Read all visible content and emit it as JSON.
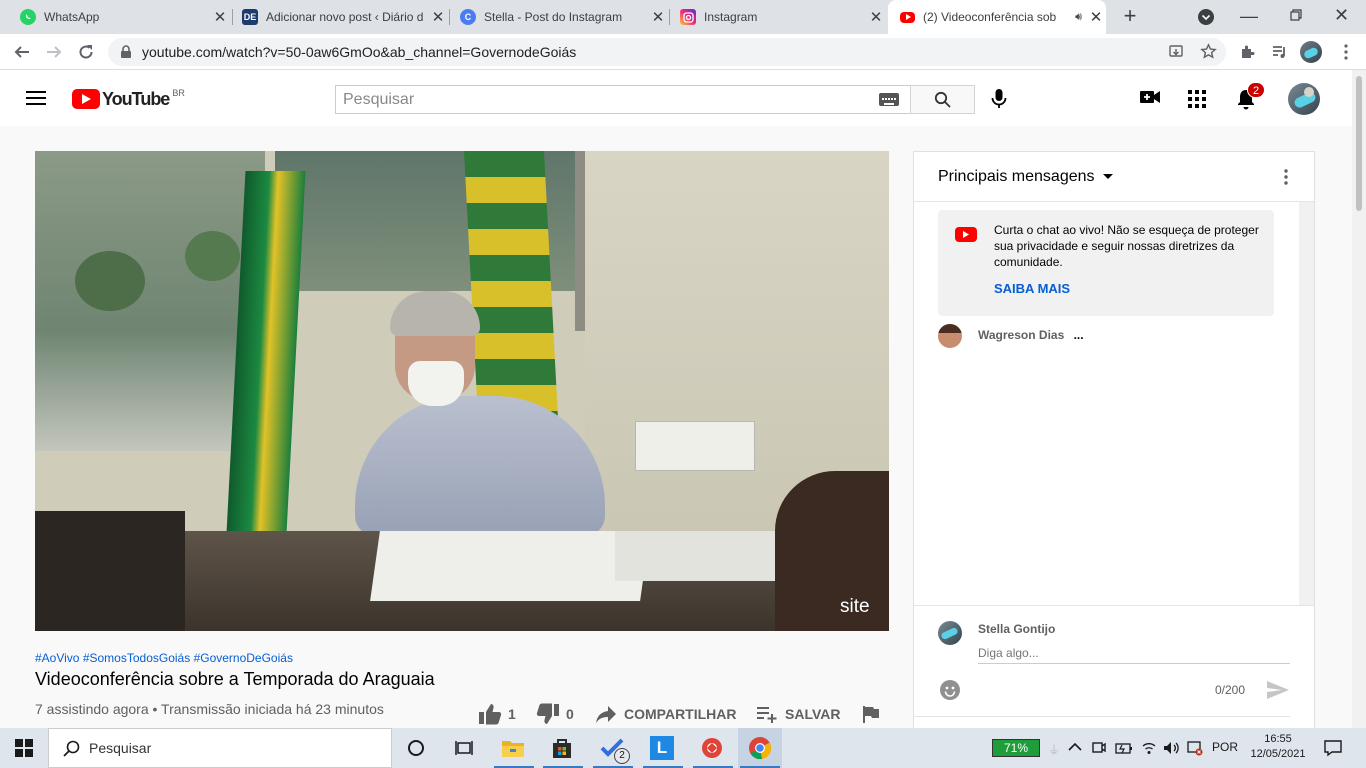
{
  "browser": {
    "tabs": [
      {
        "title": "WhatsApp",
        "icon": "whatsapp-icon",
        "color": "#25d366",
        "active": false
      },
      {
        "title": "Adicionar novo post ‹ Diário d",
        "icon": "diario-icon",
        "color": "#1d3c6e",
        "active": false
      },
      {
        "title": "Stella - Post do Instagram",
        "icon": "canva-icon",
        "color": "#4b7cf0",
        "active": false
      },
      {
        "title": "Instagram",
        "icon": "instagram-icon",
        "color": "#d62976",
        "active": false
      },
      {
        "title": "(2) Videoconferência sob",
        "icon": "youtube-icon",
        "color": "#ff0000",
        "active": true
      }
    ],
    "url": "youtube.com/watch?v=50-0aw6GmOo&ab_channel=GovernodeGoiás"
  },
  "youtube": {
    "logo_text": "YouTube",
    "country_code": "BR",
    "search_placeholder": "Pesquisar",
    "notification_count": "2",
    "brand_red": "#ff0000"
  },
  "video": {
    "watermark": "site",
    "hashtags": [
      "#AoVivo",
      "#SomosTodosGoiás",
      "#GovernoDeGoiás"
    ],
    "title": "Videoconferência sobre a Temporada do Araguaia",
    "meta": "7 assistindo agora • Transmissão iniciada há 23 minutos",
    "likes": "1",
    "dislikes": "0",
    "share_label": "COMPARTILHAR",
    "save_label": "SALVAR"
  },
  "chat": {
    "header": "Principais mensagens",
    "notice_text": "Curta o chat ao vivo! Não se esqueça de proteger sua privacidade e seguir nossas diretrizes da comunidade.",
    "notice_link": "SAIBA MAIS",
    "messages": [
      {
        "author": "Wagreson Dias",
        "text": "..."
      }
    ],
    "current_user": "Stella Gontijo",
    "input_placeholder": "Diga algo...",
    "char_counter": "0/200",
    "link_color": "#065fd4"
  },
  "taskbar": {
    "search_placeholder": "Pesquisar",
    "battery": "71%",
    "language": "POR",
    "time": "16:55",
    "date": "12/05/2021",
    "badge_count": "2"
  }
}
